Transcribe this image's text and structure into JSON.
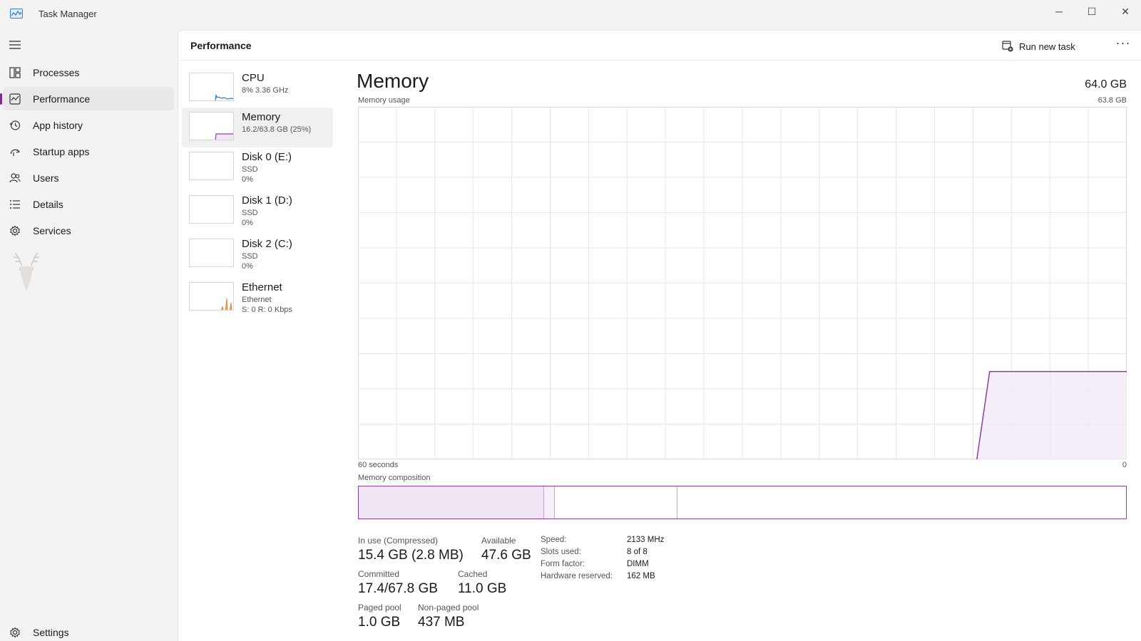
{
  "app": {
    "title": "Task Manager",
    "icon": "task-manager-icon"
  },
  "window_controls": {
    "minimize": "─",
    "maximize": "☐",
    "close": "✕"
  },
  "nav": {
    "items": [
      {
        "label": "Processes",
        "icon": "processes-icon"
      },
      {
        "label": "Performance",
        "icon": "performance-icon",
        "active": true
      },
      {
        "label": "App history",
        "icon": "history-icon"
      },
      {
        "label": "Startup apps",
        "icon": "startup-icon"
      },
      {
        "label": "Users",
        "icon": "users-icon"
      },
      {
        "label": "Details",
        "icon": "details-icon"
      },
      {
        "label": "Services",
        "icon": "services-icon"
      }
    ],
    "settings": "Settings"
  },
  "header": {
    "title": "Performance",
    "run_new_task": "Run new task",
    "more": "···"
  },
  "devices": [
    {
      "name": "CPU",
      "line1": "8%  3.36 GHz",
      "line2": ""
    },
    {
      "name": "Memory",
      "line1": "16.2/63.8 GB (25%)",
      "line2": "",
      "selected": true
    },
    {
      "name": "Disk 0 (E:)",
      "line1": "SSD",
      "line2": "0%"
    },
    {
      "name": "Disk 1 (D:)",
      "line1": "SSD",
      "line2": "0%"
    },
    {
      "name": "Disk 2 (C:)",
      "line1": "SSD",
      "line2": "0%"
    },
    {
      "name": "Ethernet",
      "line1": "Ethernet",
      "line2": "S: 0  R: 0 Kbps"
    }
  ],
  "memory": {
    "title": "Memory",
    "total": "64.0 GB",
    "usage_label": "Memory usage",
    "usage_max": "63.8 GB",
    "axis_left": "60 seconds",
    "axis_right": "0",
    "composition_label": "Memory composition",
    "composition": {
      "in_use_fraction": 0.242,
      "modified_fraction": 0.014,
      "standby_fraction": 0.159
    },
    "stats": {
      "in_use_label": "In use (Compressed)",
      "in_use_value": "15.4 GB (2.8 MB)",
      "available_label": "Available",
      "available_value": "47.6 GB",
      "committed_label": "Committed",
      "committed_value": "17.4/67.8 GB",
      "cached_label": "Cached",
      "cached_value": "11.0 GB",
      "paged_label": "Paged pool",
      "paged_value": "1.0 GB",
      "nonpaged_label": "Non-paged pool",
      "nonpaged_value": "437 MB"
    },
    "specs": [
      {
        "label": "Speed:",
        "value": "2133 MHz"
      },
      {
        "label": "Slots used:",
        "value": "8 of 8"
      },
      {
        "label": "Form factor:",
        "value": "DIMM"
      },
      {
        "label": "Hardware reserved:",
        "value": "162 MB"
      }
    ]
  },
  "chart_data": {
    "type": "area",
    "title": "Memory usage",
    "xlabel": "",
    "ylabel": "",
    "x_range_seconds": [
      60,
      0
    ],
    "ylim_gb": [
      0,
      63.8
    ],
    "grid": true,
    "color": "#8b3fa3",
    "fill": "#f1e6f4",
    "points_seconds_ago": [
      60,
      11.7,
      10.7,
      0
    ],
    "series": [
      {
        "values_gb": [
          0,
          0,
          15.9,
          15.9
        ],
        "start_from_seconds_ago": 11.7
      }
    ]
  },
  "colors": {
    "accent": "#8b3fa3",
    "grid": "#e6e6e6"
  }
}
